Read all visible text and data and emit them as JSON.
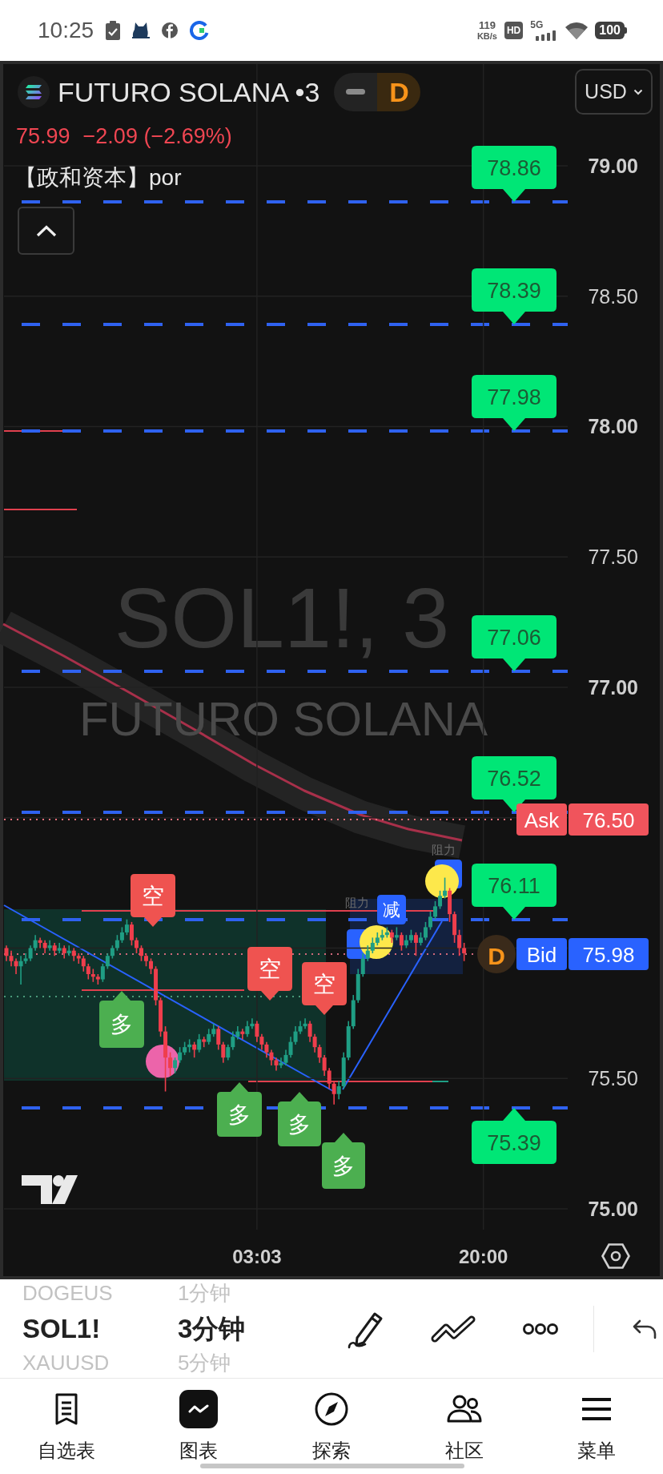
{
  "status_bar": {
    "time": "10:25",
    "speed": "119",
    "speed_unit": "KB/s",
    "hd": "HD",
    "network": "5G",
    "battery": "100"
  },
  "chart_header": {
    "title": "FUTURO SOLANA •3",
    "mode_toggle": [
      {
        "kind": "dash",
        "selected": false
      },
      {
        "kind": "letter",
        "label": "D",
        "selected": true
      }
    ],
    "currency": "USD",
    "quote": {
      "falling": true,
      "last": "75.99",
      "change": "−2.09 (−2.69%)"
    },
    "indicator": "【政和资本】por"
  },
  "chart": {
    "watermark": {
      "symbol": "SOL1!, 3",
      "name": "FUTURO SOLANA"
    },
    "chart_data": {
      "type": "candlestick",
      "grid": true,
      "ylim": [
        74.92,
        79.39
      ],
      "yticks": [
        {
          "value": 79,
          "label": "79.00"
        },
        {
          "value": 78.5,
          "label": "78.50"
        },
        {
          "value": 78,
          "label": "78.00"
        },
        {
          "value": 77.5,
          "label": "77.50"
        },
        {
          "value": 77,
          "label": "77.00"
        },
        {
          "value": 75.5,
          "label": "75.50"
        },
        {
          "value": 75,
          "label": "75.00"
        }
      ],
      "categories": [
        null,
        null,
        null,
        null,
        null,
        null,
        null,
        null,
        null,
        null,
        null,
        null,
        null,
        null,
        null,
        null,
        null,
        null,
        null,
        null,
        null,
        null,
        null,
        null,
        null,
        null,
        null,
        null,
        null,
        null,
        null,
        null,
        null,
        null,
        null,
        null,
        null,
        null,
        null,
        null,
        null,
        null,
        null,
        null,
        null,
        null,
        null,
        null,
        null,
        null,
        null,
        null,
        "03:03",
        null,
        null,
        null,
        null,
        null,
        null,
        null,
        null,
        null,
        null,
        null,
        null,
        null,
        null,
        null,
        null,
        null,
        null,
        null,
        null,
        null,
        null,
        null,
        null,
        null,
        null,
        null,
        null,
        null,
        null,
        null,
        null,
        null,
        null,
        null,
        null,
        null,
        null,
        null,
        null,
        null,
        null,
        null,
        null,
        null,
        null,
        "20:00",
        null,
        null,
        null,
        null,
        null,
        null,
        null,
        null,
        null,
        null,
        null,
        null,
        null,
        null,
        null,
        null,
        null
      ],
      "ohlc": [
        [
          76.0,
          76.01,
          75.95,
          75.97
        ],
        [
          75.97,
          75.99,
          75.93,
          75.95
        ],
        [
          75.95,
          75.96,
          75.9,
          75.93
        ],
        [
          75.93,
          75.97,
          75.86,
          75.95
        ],
        [
          75.95,
          75.98,
          75.94,
          75.96
        ],
        [
          75.96,
          76.01,
          75.95,
          76.0
        ],
        [
          76.0,
          76.05,
          75.99,
          76.03
        ],
        [
          76.03,
          76.04,
          76.0,
          76.02
        ],
        [
          76.02,
          76.03,
          75.98,
          76.0
        ],
        [
          76.0,
          76.03,
          75.99,
          76.01
        ],
        [
          76.01,
          76.02,
          75.97,
          75.99
        ],
        [
          75.99,
          76.02,
          75.98,
          76.0
        ],
        [
          76.0,
          76.01,
          75.96,
          75.98
        ],
        [
          75.98,
          76.01,
          75.97,
          75.99
        ],
        [
          75.99,
          76.0,
          75.95,
          75.97
        ],
        [
          75.97,
          75.98,
          75.94,
          75.96
        ],
        [
          75.96,
          75.97,
          75.91,
          75.93
        ],
        [
          75.93,
          75.94,
          75.88,
          75.9
        ],
        [
          75.9,
          75.92,
          75.87,
          75.89
        ],
        [
          75.89,
          75.9,
          75.86,
          75.88
        ],
        [
          75.88,
          75.94,
          75.87,
          75.93
        ],
        [
          75.93,
          75.98,
          75.92,
          75.97
        ],
        [
          75.97,
          76.01,
          75.96,
          76.0
        ],
        [
          76.0,
          76.05,
          75.99,
          76.03
        ],
        [
          76.03,
          76.08,
          76.02,
          76.06
        ],
        [
          76.06,
          76.11,
          76.05,
          76.09
        ],
        [
          76.09,
          76.1,
          76.01,
          76.03
        ],
        [
          76.03,
          76.04,
          75.98,
          76.0
        ],
        [
          76.0,
          76.01,
          75.95,
          75.97
        ],
        [
          75.97,
          75.98,
          75.93,
          75.95
        ],
        [
          75.95,
          75.96,
          75.9,
          75.92
        ],
        [
          75.92,
          75.93,
          75.78,
          75.8
        ],
        [
          75.8,
          75.81,
          75.66,
          75.68
        ],
        [
          75.68,
          75.7,
          75.45,
          75.58
        ],
        [
          75.58,
          75.6,
          75.51,
          75.54
        ],
        [
          75.54,
          75.58,
          75.52,
          75.57
        ],
        [
          75.57,
          75.62,
          75.56,
          75.6
        ],
        [
          75.6,
          75.64,
          75.59,
          75.62
        ],
        [
          75.62,
          75.65,
          75.6,
          75.63
        ],
        [
          75.63,
          75.64,
          75.58,
          75.61
        ],
        [
          75.61,
          75.67,
          75.6,
          75.65
        ],
        [
          75.65,
          75.66,
          75.62,
          75.64
        ],
        [
          75.64,
          75.69,
          75.63,
          75.67
        ],
        [
          75.67,
          75.71,
          75.66,
          75.69
        ],
        [
          75.69,
          75.7,
          75.61,
          75.63
        ],
        [
          75.63,
          75.64,
          75.56,
          75.58
        ],
        [
          75.58,
          75.63,
          75.57,
          75.62
        ],
        [
          75.62,
          75.68,
          75.61,
          75.66
        ],
        [
          75.66,
          75.7,
          75.65,
          75.68
        ],
        [
          75.68,
          75.69,
          75.65,
          75.67
        ],
        [
          75.67,
          75.72,
          75.66,
          75.7
        ],
        [
          75.7,
          75.73,
          75.69,
          75.71
        ],
        [
          75.71,
          75.72,
          75.64,
          75.66
        ],
        [
          75.66,
          75.67,
          75.61,
          75.63
        ],
        [
          75.63,
          75.64,
          75.58,
          75.6
        ],
        [
          75.6,
          75.61,
          75.55,
          75.57
        ],
        [
          75.57,
          75.58,
          75.53,
          75.55
        ],
        [
          75.55,
          75.58,
          75.54,
          75.56
        ],
        [
          75.56,
          75.61,
          75.55,
          75.59
        ],
        [
          75.59,
          75.66,
          75.58,
          75.64
        ],
        [
          75.64,
          75.7,
          75.63,
          75.68
        ],
        [
          75.68,
          75.72,
          75.67,
          75.7
        ],
        [
          75.7,
          75.73,
          75.69,
          75.71
        ],
        [
          75.71,
          75.72,
          75.64,
          75.66
        ],
        [
          75.66,
          75.67,
          75.6,
          75.62
        ],
        [
          75.62,
          75.63,
          75.56,
          75.58
        ],
        [
          75.58,
          75.59,
          75.51,
          75.53
        ],
        [
          75.53,
          75.54,
          75.46,
          75.48
        ],
        [
          75.48,
          75.49,
          75.4,
          75.44
        ],
        [
          75.44,
          75.49,
          75.42,
          75.47
        ],
        [
          75.47,
          75.6,
          75.46,
          75.58
        ],
        [
          75.58,
          75.72,
          75.57,
          75.7
        ],
        [
          75.7,
          75.82,
          75.69,
          75.8
        ],
        [
          75.8,
          75.92,
          75.79,
          75.9
        ],
        [
          75.9,
          75.98,
          75.89,
          75.96
        ],
        [
          75.96,
          76.01,
          75.95,
          75.99
        ],
        [
          75.99,
          76.04,
          75.98,
          76.02
        ],
        [
          76.02,
          76.06,
          76.01,
          76.04
        ],
        [
          76.04,
          76.07,
          76.03,
          76.05
        ],
        [
          76.05,
          76.08,
          76.04,
          76.06
        ],
        [
          76.06,
          76.07,
          76.02,
          76.04
        ],
        [
          76.04,
          76.08,
          76.03,
          76.05
        ],
        [
          76.05,
          76.06,
          75.99,
          76.01
        ],
        [
          76.01,
          76.05,
          76.0,
          76.03
        ],
        [
          76.03,
          76.07,
          76.02,
          76.05
        ],
        [
          76.05,
          76.06,
          75.97,
          76.02
        ],
        [
          76.02,
          76.06,
          76.01,
          76.04
        ],
        [
          76.04,
          76.1,
          76.03,
          76.08
        ],
        [
          76.08,
          76.14,
          76.07,
          76.12
        ],
        [
          76.12,
          76.18,
          76.11,
          76.16
        ],
        [
          76.16,
          76.22,
          76.15,
          76.2
        ],
        [
          76.2,
          76.27,
          76.19,
          76.22
        ],
        [
          76.22,
          76.23,
          76.1,
          76.13
        ],
        [
          76.13,
          76.14,
          76.02,
          76.05
        ],
        [
          76.05,
          76.07,
          75.97,
          76.0
        ],
        [
          76.0,
          76.02,
          75.95,
          75.98
        ],
        null,
        null,
        null,
        null,
        null,
        null,
        null,
        null,
        null,
        null,
        null,
        null,
        null,
        null,
        null,
        null,
        null,
        null,
        null,
        null,
        null
      ]
    },
    "price_levels": [
      {
        "label": "78.86",
        "label_below": false
      },
      {
        "label": "78.39",
        "label_below": false
      },
      {
        "label": "77.98",
        "label_below": false
      },
      {
        "label": "77.06",
        "label_below": false
      },
      {
        "label": "76.52",
        "label_below": false
      },
      {
        "label": "76.11",
        "label_below": false
      },
      {
        "label": "75.39",
        "label_below": true
      }
    ],
    "quote_lines": [
      {
        "kind": "ask",
        "label": "Ask",
        "price": "76.50"
      },
      {
        "kind": "bid",
        "label": "Bid",
        "price": "75.98"
      }
    ],
    "event_marker": "D",
    "signals": [
      {
        "kind": "long",
        "label": "多"
      },
      {
        "kind": "short",
        "label": "空"
      },
      {
        "kind": "long",
        "label": "多"
      },
      {
        "kind": "short",
        "label": "空"
      },
      {
        "kind": "long",
        "label": "多"
      },
      {
        "kind": "short",
        "label": "空"
      },
      {
        "kind": "long",
        "label": "多"
      },
      {
        "kind": "exit"
      },
      {
        "kind": "exit",
        "label": "减"
      },
      {
        "kind": "exit"
      }
    ],
    "markers": [
      {
        "color": "#ec64aa"
      },
      {
        "color": "#fde84b"
      },
      {
        "color": "#fde84b"
      }
    ],
    "zone_labels": [
      "阻力",
      "阻力"
    ]
  },
  "symbol_picker": [
    {
      "label": "DOGEUS",
      "selected": false
    },
    {
      "label": "SOL1!",
      "selected": true
    },
    {
      "label": "XAUUSD",
      "selected": false
    }
  ],
  "interval_picker": [
    {
      "label": "1分钟",
      "selected": false
    },
    {
      "label": "3分钟",
      "selected": true
    },
    {
      "label": "5分钟",
      "selected": false
    }
  ],
  "bottom_nav": [
    {
      "kind": "watchlist",
      "label": "自选表",
      "selected": false
    },
    {
      "kind": "chart",
      "label": "图表",
      "selected": true
    },
    {
      "kind": "explore",
      "label": "探索",
      "selected": false
    },
    {
      "kind": "community",
      "label": "社区",
      "selected": false
    },
    {
      "kind": "menu",
      "label": "菜单",
      "selected": false
    }
  ]
}
